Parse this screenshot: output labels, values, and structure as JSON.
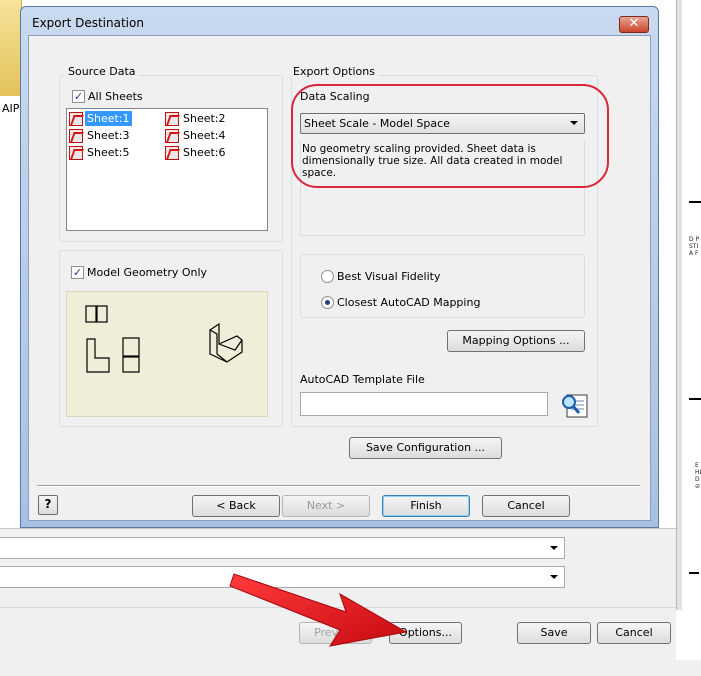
{
  "background": {
    "sidebar_label": "AIP",
    "preview_button": "Preview",
    "options_button": "Options...",
    "save_button": "Save",
    "cancel_button": "Cancel"
  },
  "dialog": {
    "title": "Export Destination",
    "close_glyph": "✕",
    "source_data": {
      "label": "Source Data",
      "all_sheets_label": "All Sheets",
      "all_sheets_checked": true,
      "sheets": [
        {
          "label": "Sheet:1",
          "selected": true
        },
        {
          "label": "Sheet:2",
          "selected": false
        },
        {
          "label": "Sheet:3",
          "selected": false
        },
        {
          "label": "Sheet:4",
          "selected": false
        },
        {
          "label": "Sheet:5",
          "selected": false
        },
        {
          "label": "Sheet:6",
          "selected": false
        }
      ]
    },
    "model_geometry_only_label": "Model Geometry Only",
    "model_geometry_only_checked": true,
    "export_options": {
      "label": "Export Options",
      "data_scaling_label": "Data Scaling",
      "data_scaling_value": "Sheet Scale - Model Space",
      "data_scaling_description": "No geometry scaling provided. Sheet data is dimensionally true size. All data created in model space.",
      "best_visual_fidelity_label": "Best Visual Fidelity",
      "closest_mapping_label": "Closest AutoCAD Mapping",
      "selected_mapping": "closest",
      "mapping_options_button": "Mapping Options ...",
      "template_file_label": "AutoCAD Template File",
      "template_file_value": ""
    },
    "save_configuration_button": "Save Configuration ...",
    "help_glyph": "?",
    "back_button": "< Back",
    "next_button": "Next >",
    "finish_button": "Finish",
    "cancel_button": "Cancel"
  },
  "colors": {
    "highlight": "#d9263a",
    "arrow": "#e3101a",
    "selection": "#3399ff"
  }
}
